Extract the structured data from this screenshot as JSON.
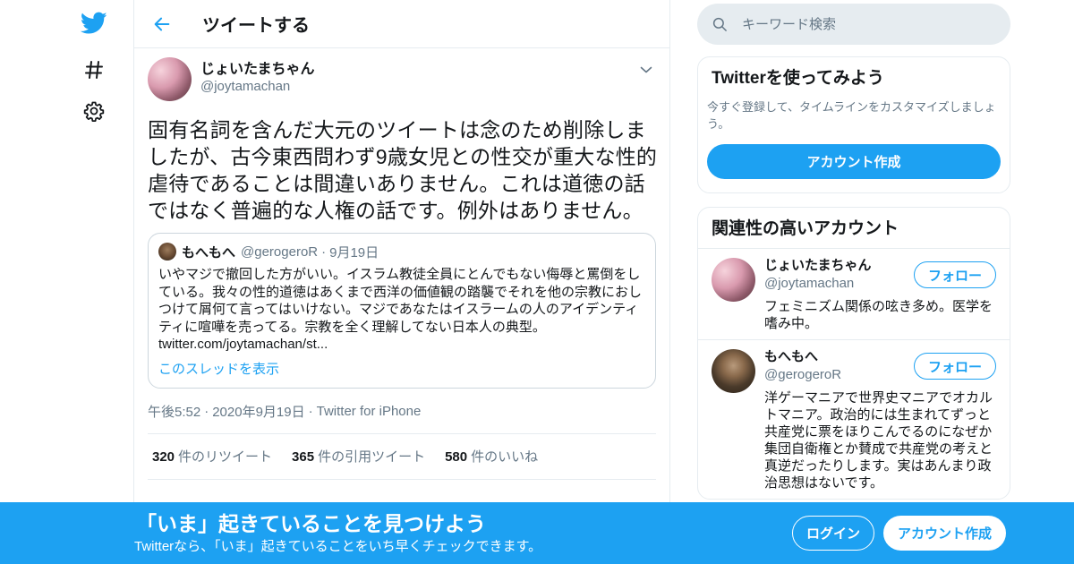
{
  "colors": {
    "accent": "#1da1f2",
    "text": "#14171a",
    "muted": "#657786",
    "border": "#e6ecf0"
  },
  "nav": {
    "logo_icon": "twitter-bird-icon",
    "explore_icon": "hashtag-icon",
    "settings_icon": "gear-icon"
  },
  "header": {
    "back_icon": "arrow-left-icon",
    "title": "ツイートする"
  },
  "tweet": {
    "display_name": "じょいたまちゃん",
    "handle": "@joytamachan",
    "text": "固有名詞を含んだ大元のツイートは念のため削除しましたが、古今東西問わず9歳女児との性交が重大な性的虐待であることは間違いありません。これは道徳の話ではなく普遍的な人権の話です。例外はありません。",
    "quote": {
      "display_name": "もへもへ",
      "handle": "@gerogeroR",
      "dot": "·",
      "date": "9月19日",
      "text": "いやマジで撤回した方がいい。イスラム教徒全員にとんでもない侮辱と罵倒をしている。我々の性的道徳はあくまで西洋の価値観の踏襲でそれを他の宗教におしつけて屑何て言ってはいけない。マジであなたはイスラームの人のアイデンティティに喧嘩を売ってる。宗教を全く理解してない日本人の典型。",
      "link": "twitter.com/joytamachan/st...",
      "thread_link": "このスレッドを表示"
    },
    "time": "午後5:52",
    "date": "2020年9月19日",
    "sep": "·",
    "source": "Twitter for iPhone",
    "stats": {
      "retweets_count": "320",
      "retweets_label": "件のリツイート",
      "quotes_count": "365",
      "quotes_label": "件の引用ツイート",
      "likes_count": "580",
      "likes_label": "件のいいね"
    }
  },
  "search": {
    "placeholder": "キーワード検索"
  },
  "signup_card": {
    "title": "Twitterを使ってみよう",
    "description": "今すぐ登録して、タイムラインをカスタマイズしましょう。",
    "button": "アカウント作成"
  },
  "related": {
    "title": "関連性の高いアカウント",
    "accounts": [
      {
        "display_name": "じょいたまちゃん",
        "handle": "@joytamachan",
        "bio": "フェミニズム関係の呟き多め。医学を嗜み中。",
        "follow": "フォロー"
      },
      {
        "display_name": "もへもへ",
        "handle": "@gerogeroR",
        "bio": "洋ゲーマニアで世界史マニアでオカルトマニア。政治的には生まれてずっと共産党に票をほりこんでるのになぜか集団自衛権とか賛成で共産党の考えと真逆だったりします。実はあんまり政治思想はないです。",
        "follow": "フォロー"
      }
    ]
  },
  "banner": {
    "title": "「いま」起きていることを見つけよう",
    "subtitle": "Twitterなら、「いま」起きていることをいち早くチェックできます。",
    "login": "ログイン",
    "signup": "アカウント作成"
  }
}
